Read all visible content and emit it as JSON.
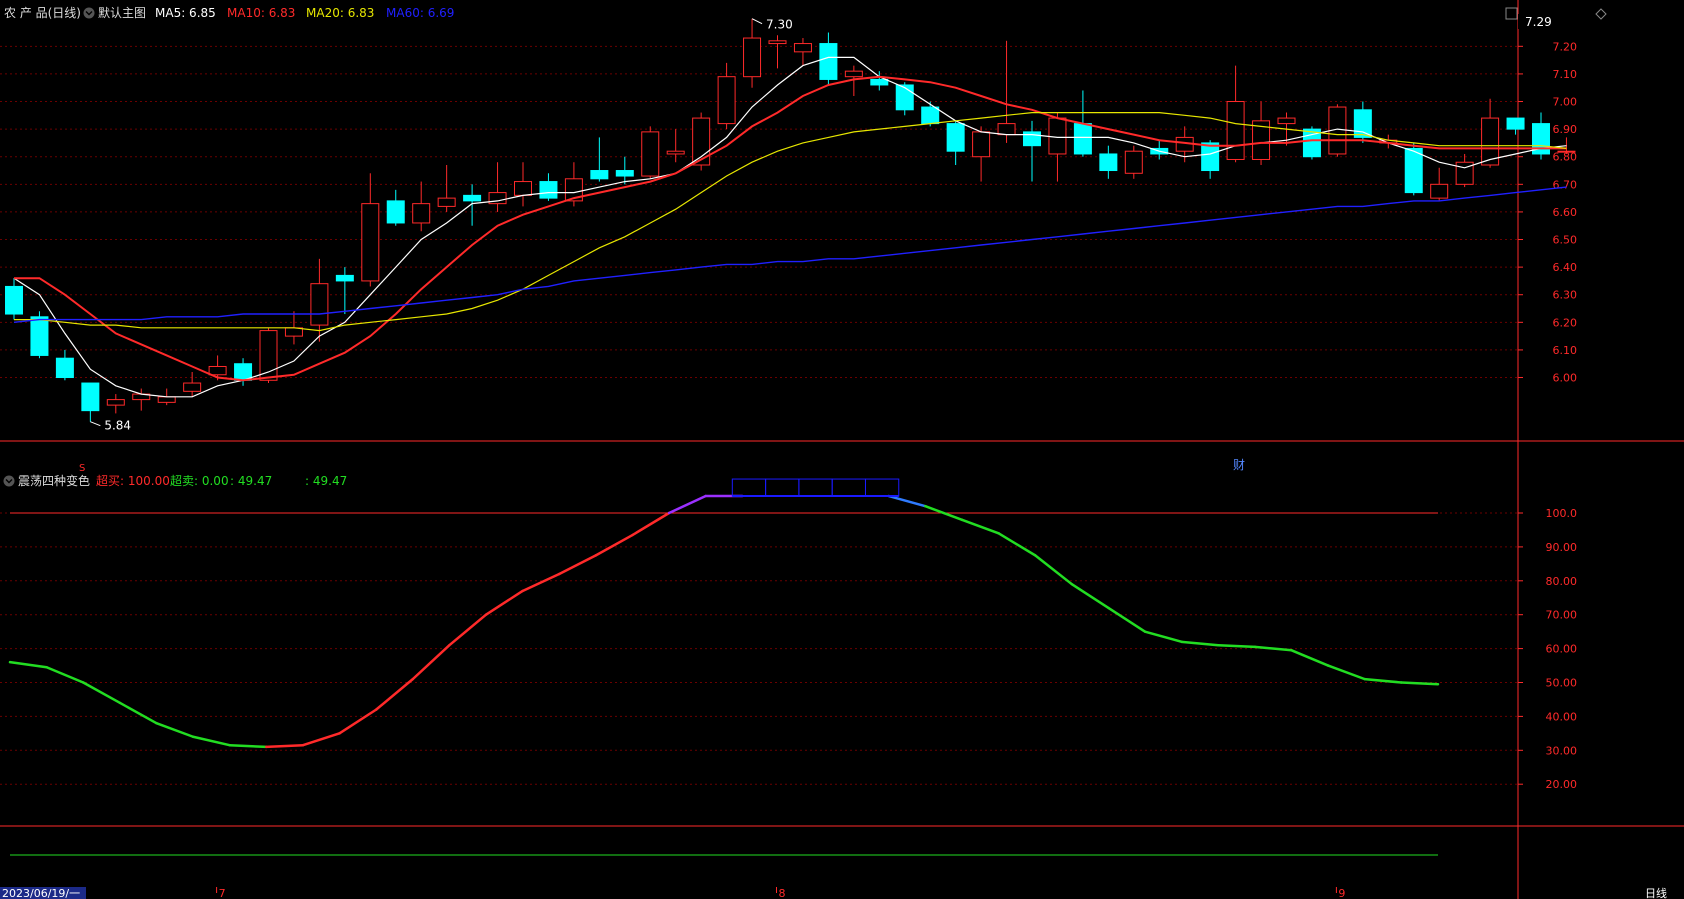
{
  "main_header": {
    "title": "农 产 品(日线)",
    "template": "默认主图",
    "ma5": {
      "label": "MA5: 6.85",
      "color": "#ffffff"
    },
    "ma10": {
      "label": "MA10: 6.83",
      "color": "#ff2a2a"
    },
    "ma20": {
      "label": "MA20: 6.83",
      "color": "#e6e600"
    },
    "ma60": {
      "label": "MA60: 6.69",
      "color": "#2020ff"
    }
  },
  "indicator_header": {
    "title": "震荡四种变色",
    "overbought": {
      "label": "超买: 100.00",
      "color": "#ff2a2a"
    },
    "oversold": {
      "label": "超卖: 0.00",
      "color": "#22dd22"
    },
    "value1": {
      "label": ": 49.47",
      "color": "#22dd22"
    },
    "value2": {
      "label": ": 49.47",
      "color": "#22dd22"
    }
  },
  "price_badge": "7.29",
  "axis_labels": {
    "date_start": "2023/06/19/一",
    "timeframe": "日线",
    "marker_finance": "财",
    "marker_s": "S"
  },
  "annotations": {
    "high": "7.30",
    "low": "5.84"
  },
  "colors": {
    "up": "#ff2a2a",
    "down": "#00ffff",
    "grid": "#6b0000",
    "axis": "#ff2a2a",
    "bg": "#000000"
  },
  "icons": [
    "collapse-icon",
    "dropdown-icon",
    "diamond-icon",
    "settings-icon"
  ],
  "chart_data": [
    {
      "type": "candlestick",
      "title": "农 产 品(日线)",
      "ylim": [
        5.79,
        7.33
      ],
      "yticks": [
        "6.00",
        "6.10",
        "6.20",
        "6.30",
        "6.40",
        "6.50",
        "6.60",
        "6.70",
        "6.80",
        "6.90",
        "7.00",
        "7.10",
        "7.20"
      ],
      "xticks": [
        {
          "label": "7",
          "index": 8
        },
        {
          "label": "8",
          "index": 30
        },
        {
          "label": "9",
          "index": 52
        }
      ],
      "candles": [
        [
          6.33,
          6.23,
          6.36,
          6.21
        ],
        [
          6.22,
          6.08,
          6.24,
          6.07
        ],
        [
          6.07,
          6.0,
          6.1,
          5.99
        ],
        [
          5.98,
          5.88,
          5.98,
          5.84
        ],
        [
          5.9,
          5.92,
          5.94,
          5.87
        ],
        [
          5.92,
          5.94,
          5.96,
          5.88
        ],
        [
          5.91,
          5.93,
          5.96,
          5.9
        ],
        [
          5.95,
          5.98,
          6.02,
          5.93
        ],
        [
          6.01,
          6.04,
          6.08,
          5.99
        ],
        [
          6.05,
          5.99,
          6.07,
          5.97
        ],
        [
          5.99,
          6.17,
          6.18,
          5.98
        ],
        [
          6.15,
          6.18,
          6.24,
          6.12
        ],
        [
          6.19,
          6.34,
          6.43,
          6.13
        ],
        [
          6.37,
          6.35,
          6.4,
          6.23
        ],
        [
          6.35,
          6.63,
          6.74,
          6.33
        ],
        [
          6.64,
          6.56,
          6.68,
          6.55
        ],
        [
          6.56,
          6.63,
          6.71,
          6.53
        ],
        [
          6.62,
          6.65,
          6.77,
          6.6
        ],
        [
          6.66,
          6.64,
          6.7,
          6.55
        ],
        [
          6.63,
          6.67,
          6.78,
          6.6
        ],
        [
          6.66,
          6.71,
          6.78,
          6.62
        ],
        [
          6.71,
          6.65,
          6.74,
          6.64
        ],
        [
          6.64,
          6.72,
          6.78,
          6.62
        ],
        [
          6.75,
          6.72,
          6.87,
          6.71
        ],
        [
          6.75,
          6.73,
          6.8,
          6.7
        ],
        [
          6.73,
          6.89,
          6.91,
          6.72
        ],
        [
          6.81,
          6.82,
          6.9,
          6.78
        ],
        [
          6.77,
          6.94,
          6.96,
          6.75
        ],
        [
          6.92,
          7.09,
          7.14,
          6.9
        ],
        [
          7.09,
          7.23,
          7.3,
          7.05
        ],
        [
          7.21,
          7.22,
          7.24,
          7.12
        ],
        [
          7.18,
          7.21,
          7.23,
          7.13
        ],
        [
          7.21,
          7.08,
          7.25,
          7.06
        ],
        [
          7.09,
          7.11,
          7.13,
          7.02
        ],
        [
          7.08,
          7.06,
          7.11,
          7.04
        ],
        [
          7.06,
          6.97,
          7.07,
          6.95
        ],
        [
          6.98,
          6.92,
          7.0,
          6.91
        ],
        [
          6.92,
          6.82,
          6.93,
          6.77
        ],
        [
          6.8,
          6.89,
          6.91,
          6.71
        ],
        [
          6.88,
          6.92,
          7.22,
          6.85
        ],
        [
          6.89,
          6.84,
          6.93,
          6.71
        ],
        [
          6.81,
          6.94,
          6.96,
          6.71
        ],
        [
          6.92,
          6.81,
          7.04,
          6.8
        ],
        [
          6.81,
          6.75,
          6.84,
          6.72
        ],
        [
          6.74,
          6.82,
          6.84,
          6.72
        ],
        [
          6.83,
          6.81,
          6.86,
          6.79
        ],
        [
          6.82,
          6.87,
          6.91,
          6.78
        ],
        [
          6.85,
          6.75,
          6.86,
          6.72
        ],
        [
          6.79,
          7.0,
          7.13,
          6.78
        ],
        [
          6.79,
          6.93,
          7.0,
          6.77
        ],
        [
          6.92,
          6.94,
          6.96,
          6.84
        ],
        [
          6.9,
          6.8,
          6.91,
          6.79
        ],
        [
          6.81,
          6.98,
          6.99,
          6.8
        ],
        [
          6.97,
          6.87,
          7.0,
          6.85
        ],
        [
          6.85,
          6.86,
          6.88,
          6.83
        ],
        [
          6.83,
          6.67,
          6.85,
          6.66
        ],
        [
          6.65,
          6.7,
          6.76,
          6.64
        ],
        [
          6.7,
          6.78,
          6.81,
          6.69
        ],
        [
          6.77,
          6.94,
          7.01,
          6.76
        ],
        [
          6.94,
          6.9,
          6.94,
          6.88
        ],
        [
          6.92,
          6.81,
          6.96,
          6.79
        ],
        [
          6.82,
          6.82,
          6.87,
          6.81
        ]
      ],
      "series": [
        {
          "name": "MA5",
          "color": "#ffffff",
          "values": [
            6.36,
            6.3,
            6.16,
            6.03,
            5.97,
            5.94,
            5.93,
            5.93,
            5.97,
            5.99,
            6.02,
            6.06,
            6.15,
            6.2,
            6.3,
            6.4,
            6.5,
            6.56,
            6.63,
            6.64,
            6.66,
            6.67,
            6.67,
            6.69,
            6.71,
            6.72,
            6.74,
            6.8,
            6.87,
            6.98,
            7.06,
            7.13,
            7.16,
            7.16,
            7.09,
            7.05,
            6.99,
            6.93,
            6.89,
            6.88,
            6.88,
            6.87,
            6.87,
            6.87,
            6.85,
            6.82,
            6.8,
            6.81,
            6.84,
            6.85,
            6.86,
            6.88,
            6.9,
            6.89,
            6.85,
            6.82,
            6.78,
            6.76,
            6.79,
            6.81,
            6.83,
            6.84
          ]
        },
        {
          "name": "MA10",
          "color": "#ff2a2a",
          "values": [
            6.36,
            6.36,
            6.3,
            6.23,
            6.16,
            6.12,
            6.08,
            6.04,
            6.0,
            5.99,
            6.0,
            6.01,
            6.05,
            6.09,
            6.15,
            6.23,
            6.32,
            6.4,
            6.48,
            6.55,
            6.59,
            6.62,
            6.65,
            6.67,
            6.69,
            6.71,
            6.74,
            6.79,
            6.84,
            6.91,
            6.96,
            7.02,
            7.06,
            7.08,
            7.09,
            7.08,
            7.07,
            7.05,
            7.02,
            6.99,
            6.97,
            6.94,
            6.92,
            6.9,
            6.88,
            6.86,
            6.85,
            6.84,
            6.84,
            6.85,
            6.85,
            6.86,
            6.86,
            6.86,
            6.85,
            6.84,
            6.83,
            6.83,
            6.83,
            6.83,
            6.83,
            6.83
          ]
        },
        {
          "name": "MA20",
          "color": "#e6e600",
          "values": [
            6.21,
            6.21,
            6.2,
            6.19,
            6.19,
            6.18,
            6.18,
            6.18,
            6.18,
            6.18,
            6.18,
            6.18,
            6.17,
            6.19,
            6.2,
            6.21,
            6.22,
            6.23,
            6.25,
            6.28,
            6.32,
            6.37,
            6.42,
            6.47,
            6.51,
            6.56,
            6.61,
            6.67,
            6.73,
            6.78,
            6.82,
            6.85,
            6.87,
            6.89,
            6.9,
            6.91,
            6.92,
            6.93,
            6.94,
            6.95,
            6.96,
            6.96,
            6.96,
            6.96,
            6.96,
            6.96,
            6.95,
            6.94,
            6.92,
            6.91,
            6.9,
            6.89,
            6.88,
            6.88,
            6.86,
            6.85,
            6.84,
            6.84,
            6.84,
            6.84,
            6.84,
            6.83
          ]
        },
        {
          "name": "MA60",
          "color": "#2020ff",
          "values": [
            6.2,
            6.21,
            6.21,
            6.21,
            6.21,
            6.21,
            6.22,
            6.22,
            6.22,
            6.23,
            6.23,
            6.23,
            6.23,
            6.24,
            6.25,
            6.26,
            6.27,
            6.28,
            6.29,
            6.3,
            6.32,
            6.33,
            6.35,
            6.36,
            6.37,
            6.38,
            6.39,
            6.4,
            6.41,
            6.41,
            6.42,
            6.42,
            6.43,
            6.43,
            6.44,
            6.45,
            6.46,
            6.47,
            6.48,
            6.49,
            6.5,
            6.51,
            6.52,
            6.53,
            6.54,
            6.55,
            6.56,
            6.57,
            6.58,
            6.59,
            6.6,
            6.61,
            6.62,
            6.62,
            6.63,
            6.64,
            6.64,
            6.65,
            6.66,
            6.67,
            6.68,
            6.69
          ]
        }
      ]
    },
    {
      "type": "line",
      "title": "震荡四种变色",
      "ylim": [
        0,
        118
      ],
      "yticks": [
        "20.00",
        "30.00",
        "40.00",
        "50.00",
        "60.00",
        "70.00",
        "80.00",
        "90.00",
        "100.0"
      ],
      "overbought": 100,
      "oversold": 0,
      "values": [
        56,
        54.5,
        50,
        44,
        38,
        34,
        31.5,
        31,
        31.5,
        35,
        42,
        51,
        61,
        70,
        77,
        82,
        87.5,
        93.5,
        100,
        105,
        105,
        105,
        105,
        105,
        105,
        102,
        98,
        94,
        87.5,
        79,
        72,
        65,
        62,
        61,
        60.5,
        59.5,
        55,
        51,
        50,
        49.5
      ],
      "segment_colors": [
        "green",
        "green",
        "green",
        "green",
        "green",
        "green",
        "green",
        "red",
        "red",
        "red",
        "red",
        "red",
        "red",
        "red",
        "red",
        "red",
        "red",
        "red",
        "purple",
        "purple",
        "blue-box",
        "blue-box",
        "blue-box",
        "blue-box",
        "blue",
        "green",
        "green",
        "green",
        "green",
        "green",
        "green",
        "green",
        "green",
        "green",
        "green",
        "green",
        "green",
        "green",
        "green"
      ]
    }
  ]
}
